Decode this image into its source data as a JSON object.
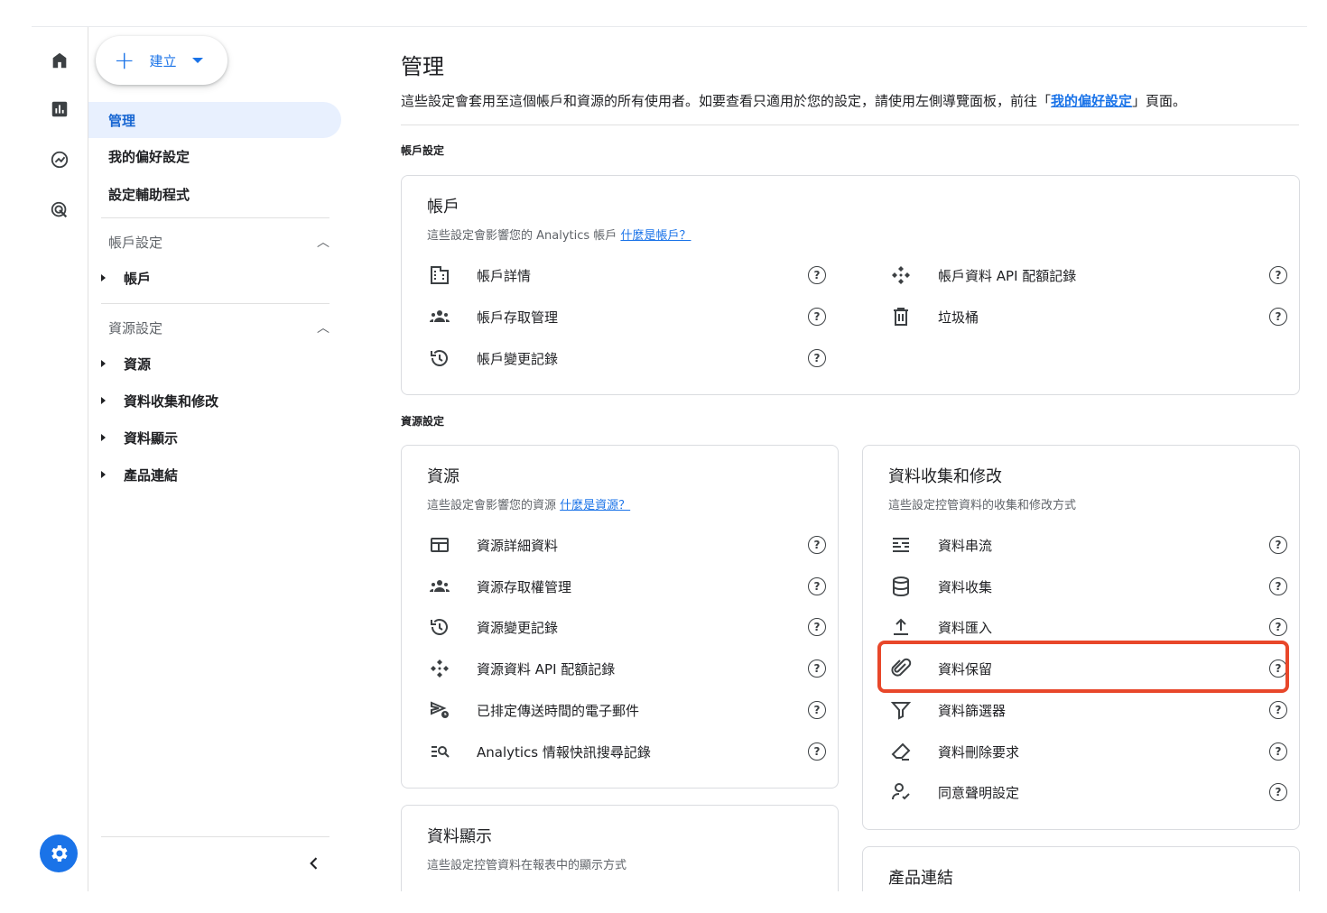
{
  "create_button": {
    "label": "建立"
  },
  "sidenav": {
    "admin": "管理",
    "my_prefs": "我的偏好設定",
    "setup_assistant": "設定輔助程式",
    "account_settings": "帳戶設定",
    "account_items": [
      "帳戶"
    ],
    "property_settings": "資源設定",
    "property_items": [
      "資源",
      "資料收集和修改",
      "資料顯示",
      "產品連結"
    ]
  },
  "main": {
    "title": "管理",
    "desc_prefix": "這些設定會套用至這個帳戶和資源的所有使用者。如要查看只適用於您的設定，請使用左側導覽面板，前往「",
    "desc_link": "我的偏好設定",
    "desc_suffix": "」頁面。",
    "account_section": "帳戶設定",
    "property_section": "資源設定"
  },
  "account_card": {
    "title": "帳戶",
    "sub": "這些設定會影響您的 Analytics 帳戶",
    "sub_link": "什麼是帳戶？",
    "left": [
      "帳戶詳情",
      "帳戶存取管理",
      "帳戶變更記錄"
    ],
    "right": [
      "帳戶資料 API 配額記錄",
      "垃圾桶"
    ]
  },
  "property_card": {
    "title": "資源",
    "sub": "這些設定會影響您的資源",
    "sub_link": "什麼是資源？",
    "items": [
      "資源詳細資料",
      "資源存取權管理",
      "資源變更記錄",
      "資源資料 API 配額記錄",
      "已排定傳送時間的電子郵件",
      "Analytics 情報快訊搜尋記錄"
    ]
  },
  "data_collection_card": {
    "title": "資料收集和修改",
    "sub": "這些設定控管資料的收集和修改方式",
    "items": [
      "資料串流",
      "資料收集",
      "資料匯入",
      "資料保留",
      "資料篩選器",
      "資料刪除要求",
      "同意聲明設定"
    ]
  },
  "data_display_card": {
    "title": "資料顯示",
    "sub": "這些設定控管資料在報表中的顯示方式"
  },
  "product_links_card": {
    "title": "產品連結"
  },
  "help_glyph": "?",
  "colors": {
    "accent": "#1a73e8",
    "highlight": "#e8472a",
    "active_bg": "#e8f0fe"
  },
  "icons": {
    "rail": [
      "home-icon",
      "reports-icon",
      "explore-icon",
      "advertising-icon"
    ],
    "settings": "gear-icon"
  }
}
